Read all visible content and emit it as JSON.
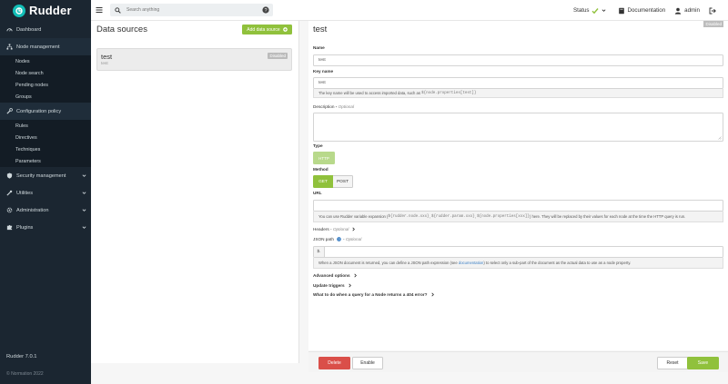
{
  "brand": {
    "name": "Rudder",
    "accent": "#13beb7"
  },
  "sidebar": {
    "items": [
      {
        "label": "Dashboard",
        "icon": "dashboard-icon"
      },
      {
        "label": "Node management",
        "icon": "sitemap-icon"
      },
      {
        "label": "Configuration policy",
        "icon": "wrench-icon"
      },
      {
        "label": "Security management",
        "icon": "shield-icon"
      },
      {
        "label": "Utilities",
        "icon": "tools-icon"
      },
      {
        "label": "Administration",
        "icon": "gear-icon"
      },
      {
        "label": "Plugins",
        "icon": "puzzle-icon"
      }
    ],
    "node_sub": [
      "Nodes",
      "Node search",
      "Pending nodes",
      "Groups"
    ],
    "config_sub": [
      "Rules",
      "Directives",
      "Techniques",
      "Parameters"
    ],
    "version": "Rudder 7.0.1",
    "copyright": "© Normation 2022"
  },
  "topbar": {
    "search_placeholder": "Search anything",
    "status": "Status",
    "documentation": "Documentation",
    "user": "admin"
  },
  "left_panel": {
    "title": "Data sources",
    "add_label": "Add data source",
    "items": [
      {
        "name": "test",
        "key": "test",
        "badge": "Disabled"
      }
    ]
  },
  "right_panel": {
    "title": "test",
    "badge": "Disabled",
    "name_label": "Name",
    "name_value": "test",
    "key_label": "Key name",
    "key_value": "test",
    "key_hint_prefix": "The key name will be used to access imported data, such as",
    "key_hint_code": "${node.properties[test]}",
    "description_label": "Description",
    "optional": "Optional",
    "type_label": "Type",
    "type_value": "HTTP",
    "method_label": "Method",
    "method_get": "GET",
    "method_post": "POST",
    "url_label": "URL",
    "url_hint_a": "You can use Rudder variable expansion (",
    "url_hint_code1": "${rudder.node.xxx}",
    "url_hint_code2": "${rudder.param.xxx}",
    "url_hint_code3": "${node.properties[xxx]}",
    "url_hint_b": ") here. They will be replaced by their values for each node at the time the HTTP query is run.",
    "headers_label": "Headers",
    "json_label": "JSON path",
    "json_prefix": "$.",
    "json_hint_a": "When a JSON document is returned, you can define a JSON path expression (see",
    "json_hint_link": "documentation",
    "json_hint_b": ") to select only a sub-part of the document as the actual data to use as a node property.",
    "advanced": "Advanced options",
    "update": "Update triggers",
    "notfound": "What to do when a query for a Node returns a 404 error?"
  },
  "footer": {
    "delete": "Delete",
    "enable": "Enable",
    "reset": "Reset",
    "save": "Save"
  }
}
